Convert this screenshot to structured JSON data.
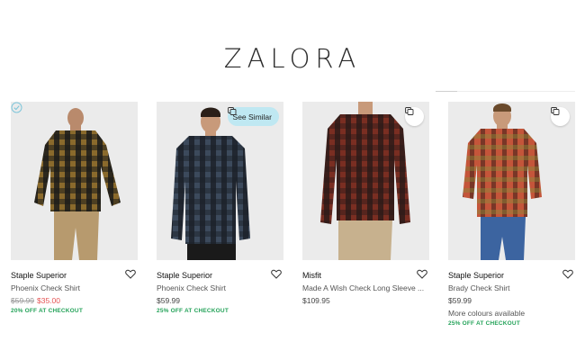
{
  "brand_logo": "ZALORA",
  "colors": {
    "accent_promo": "#25a35a",
    "sale_price": "#e55454",
    "see_similar_bg": "#bfe8f2"
  },
  "products": [
    {
      "brand": "Staple Superior",
      "name": "Phoenix Check Shirt",
      "original_price": "$59.99",
      "price": "$35.00",
      "promo": "20% OFF AT CHECKOUT",
      "overlay_icon": "check-circle-icon"
    },
    {
      "brand": "Staple Superior",
      "name": "Phoenix Check Shirt",
      "price": "$59.99",
      "promo": "25% OFF AT CHECKOUT",
      "see_similar_label": "See Similar",
      "overlay_icon": "similar-icon"
    },
    {
      "brand": "Misfit",
      "name": "Made A Wish Check Long Sleeve ...",
      "price": "$109.95",
      "overlay_icon": "similar-icon"
    },
    {
      "brand": "Staple Superior",
      "name": "Brady Check Shirt",
      "price": "$59.99",
      "colours_note": "More colours available",
      "promo": "25% OFF AT CHECKOUT",
      "overlay_icon": "similar-icon"
    }
  ]
}
